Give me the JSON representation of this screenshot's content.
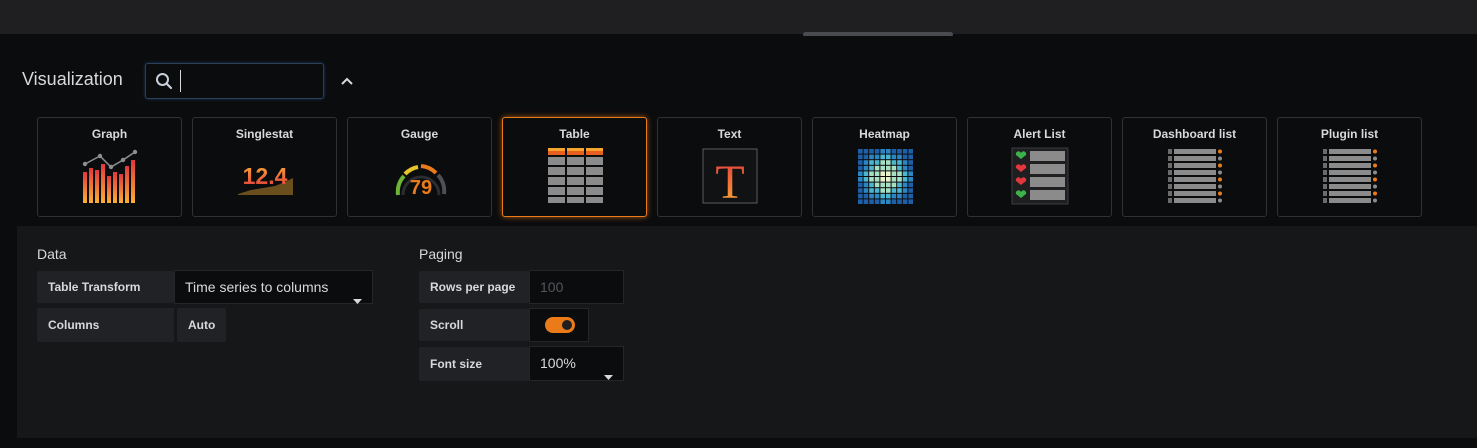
{
  "visualization": {
    "title": "Visualization",
    "search": {
      "value": "",
      "placeholder": ""
    },
    "cards": [
      {
        "label": "Graph",
        "icon": "graph-icon"
      },
      {
        "label": "Singlestat",
        "icon": "singlestat-icon",
        "value": "12.4"
      },
      {
        "label": "Gauge",
        "icon": "gauge-icon",
        "value": "79"
      },
      {
        "label": "Table",
        "icon": "table-icon",
        "selected": true
      },
      {
        "label": "Text",
        "icon": "text-icon",
        "glyph": "T"
      },
      {
        "label": "Heatmap",
        "icon": "heatmap-icon"
      },
      {
        "label": "Alert List",
        "icon": "alert-list-icon"
      },
      {
        "label": "Dashboard list",
        "icon": "dashboard-list-icon"
      },
      {
        "label": "Plugin list",
        "icon": "plugin-list-icon"
      }
    ]
  },
  "data_section": {
    "title": "Data",
    "table_transform": {
      "label": "Table Transform",
      "value": "Time series to columns"
    },
    "columns": {
      "label": "Columns",
      "button": "Auto"
    }
  },
  "paging_section": {
    "title": "Paging",
    "rows_per_page": {
      "label": "Rows per page",
      "placeholder": "100"
    },
    "scroll": {
      "label": "Scroll",
      "enabled": true
    },
    "font_size": {
      "label": "Font size",
      "value": "100%"
    }
  },
  "colors": {
    "accent": "#eb7b18",
    "background": "#0b0c0e",
    "panel": "#161719"
  }
}
